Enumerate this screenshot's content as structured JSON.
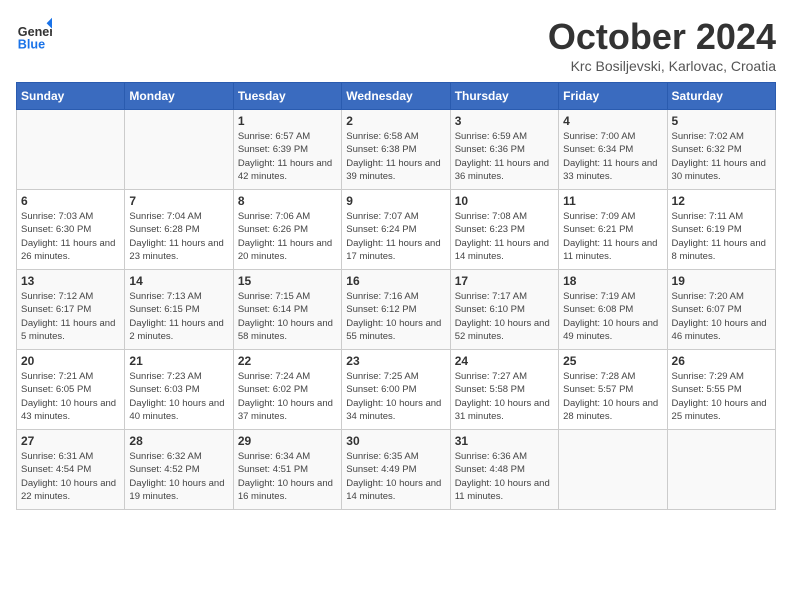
{
  "header": {
    "logo_general": "General",
    "logo_blue": "Blue",
    "month_title": "October 2024",
    "subtitle": "Krc Bosiljevski, Karlovac, Croatia"
  },
  "days_of_week": [
    "Sunday",
    "Monday",
    "Tuesday",
    "Wednesday",
    "Thursday",
    "Friday",
    "Saturday"
  ],
  "weeks": [
    [
      {
        "day": "",
        "info": ""
      },
      {
        "day": "",
        "info": ""
      },
      {
        "day": "1",
        "info": "Sunrise: 6:57 AM\nSunset: 6:39 PM\nDaylight: 11 hours and 42 minutes."
      },
      {
        "day": "2",
        "info": "Sunrise: 6:58 AM\nSunset: 6:38 PM\nDaylight: 11 hours and 39 minutes."
      },
      {
        "day": "3",
        "info": "Sunrise: 6:59 AM\nSunset: 6:36 PM\nDaylight: 11 hours and 36 minutes."
      },
      {
        "day": "4",
        "info": "Sunrise: 7:00 AM\nSunset: 6:34 PM\nDaylight: 11 hours and 33 minutes."
      },
      {
        "day": "5",
        "info": "Sunrise: 7:02 AM\nSunset: 6:32 PM\nDaylight: 11 hours and 30 minutes."
      }
    ],
    [
      {
        "day": "6",
        "info": "Sunrise: 7:03 AM\nSunset: 6:30 PM\nDaylight: 11 hours and 26 minutes."
      },
      {
        "day": "7",
        "info": "Sunrise: 7:04 AM\nSunset: 6:28 PM\nDaylight: 11 hours and 23 minutes."
      },
      {
        "day": "8",
        "info": "Sunrise: 7:06 AM\nSunset: 6:26 PM\nDaylight: 11 hours and 20 minutes."
      },
      {
        "day": "9",
        "info": "Sunrise: 7:07 AM\nSunset: 6:24 PM\nDaylight: 11 hours and 17 minutes."
      },
      {
        "day": "10",
        "info": "Sunrise: 7:08 AM\nSunset: 6:23 PM\nDaylight: 11 hours and 14 minutes."
      },
      {
        "day": "11",
        "info": "Sunrise: 7:09 AM\nSunset: 6:21 PM\nDaylight: 11 hours and 11 minutes."
      },
      {
        "day": "12",
        "info": "Sunrise: 7:11 AM\nSunset: 6:19 PM\nDaylight: 11 hours and 8 minutes."
      }
    ],
    [
      {
        "day": "13",
        "info": "Sunrise: 7:12 AM\nSunset: 6:17 PM\nDaylight: 11 hours and 5 minutes."
      },
      {
        "day": "14",
        "info": "Sunrise: 7:13 AM\nSunset: 6:15 PM\nDaylight: 11 hours and 2 minutes."
      },
      {
        "day": "15",
        "info": "Sunrise: 7:15 AM\nSunset: 6:14 PM\nDaylight: 10 hours and 58 minutes."
      },
      {
        "day": "16",
        "info": "Sunrise: 7:16 AM\nSunset: 6:12 PM\nDaylight: 10 hours and 55 minutes."
      },
      {
        "day": "17",
        "info": "Sunrise: 7:17 AM\nSunset: 6:10 PM\nDaylight: 10 hours and 52 minutes."
      },
      {
        "day": "18",
        "info": "Sunrise: 7:19 AM\nSunset: 6:08 PM\nDaylight: 10 hours and 49 minutes."
      },
      {
        "day": "19",
        "info": "Sunrise: 7:20 AM\nSunset: 6:07 PM\nDaylight: 10 hours and 46 minutes."
      }
    ],
    [
      {
        "day": "20",
        "info": "Sunrise: 7:21 AM\nSunset: 6:05 PM\nDaylight: 10 hours and 43 minutes."
      },
      {
        "day": "21",
        "info": "Sunrise: 7:23 AM\nSunset: 6:03 PM\nDaylight: 10 hours and 40 minutes."
      },
      {
        "day": "22",
        "info": "Sunrise: 7:24 AM\nSunset: 6:02 PM\nDaylight: 10 hours and 37 minutes."
      },
      {
        "day": "23",
        "info": "Sunrise: 7:25 AM\nSunset: 6:00 PM\nDaylight: 10 hours and 34 minutes."
      },
      {
        "day": "24",
        "info": "Sunrise: 7:27 AM\nSunset: 5:58 PM\nDaylight: 10 hours and 31 minutes."
      },
      {
        "day": "25",
        "info": "Sunrise: 7:28 AM\nSunset: 5:57 PM\nDaylight: 10 hours and 28 minutes."
      },
      {
        "day": "26",
        "info": "Sunrise: 7:29 AM\nSunset: 5:55 PM\nDaylight: 10 hours and 25 minutes."
      }
    ],
    [
      {
        "day": "27",
        "info": "Sunrise: 6:31 AM\nSunset: 4:54 PM\nDaylight: 10 hours and 22 minutes."
      },
      {
        "day": "28",
        "info": "Sunrise: 6:32 AM\nSunset: 4:52 PM\nDaylight: 10 hours and 19 minutes."
      },
      {
        "day": "29",
        "info": "Sunrise: 6:34 AM\nSunset: 4:51 PM\nDaylight: 10 hours and 16 minutes."
      },
      {
        "day": "30",
        "info": "Sunrise: 6:35 AM\nSunset: 4:49 PM\nDaylight: 10 hours and 14 minutes."
      },
      {
        "day": "31",
        "info": "Sunrise: 6:36 AM\nSunset: 4:48 PM\nDaylight: 10 hours and 11 minutes."
      },
      {
        "day": "",
        "info": ""
      },
      {
        "day": "",
        "info": ""
      }
    ]
  ]
}
